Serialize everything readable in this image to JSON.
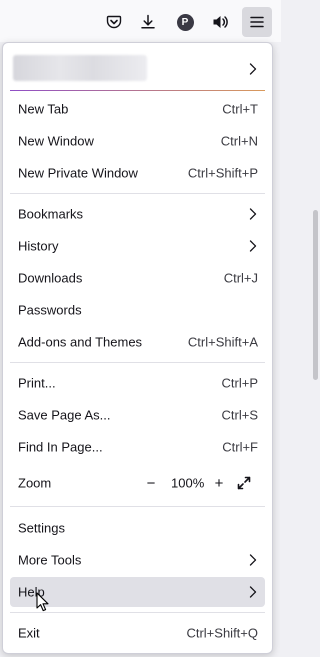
{
  "menu": {
    "group1": [
      {
        "label": "New Tab",
        "shortcut": "Ctrl+T"
      },
      {
        "label": "New Window",
        "shortcut": "Ctrl+N"
      },
      {
        "label": "New Private Window",
        "shortcut": "Ctrl+Shift+P"
      }
    ],
    "group2": [
      {
        "label": "Bookmarks",
        "shortcut": ""
      },
      {
        "label": "History",
        "shortcut": ""
      },
      {
        "label": "Downloads",
        "shortcut": "Ctrl+J"
      },
      {
        "label": "Passwords",
        "shortcut": ""
      },
      {
        "label": "Add-ons and Themes",
        "shortcut": "Ctrl+Shift+A"
      }
    ],
    "group3": [
      {
        "label": "Print...",
        "shortcut": "Ctrl+P"
      },
      {
        "label": "Save Page As...",
        "shortcut": "Ctrl+S"
      },
      {
        "label": "Find In Page...",
        "shortcut": "Ctrl+F"
      }
    ],
    "zoom": {
      "label": "Zoom",
      "minus": "−",
      "value": "100%",
      "plus": "+"
    },
    "group4": [
      {
        "label": "Settings",
        "shortcut": ""
      },
      {
        "label": "More Tools",
        "shortcut": ""
      },
      {
        "label": "Help",
        "shortcut": ""
      }
    ],
    "exit": {
      "label": "Exit",
      "shortcut": "Ctrl+Shift+Q"
    }
  },
  "toolbar": {
    "profile_initial": "P",
    "icons": [
      "pocket-icon",
      "download-icon",
      "profile-avatar",
      "speaker-icon",
      "hamburger-menu-icon"
    ]
  },
  "colors": {
    "panel_bg": "#ffffff",
    "hover_bg": "#e0e0e6",
    "accent_start": "#8f4ec6",
    "accent_end": "#d99a5c"
  }
}
